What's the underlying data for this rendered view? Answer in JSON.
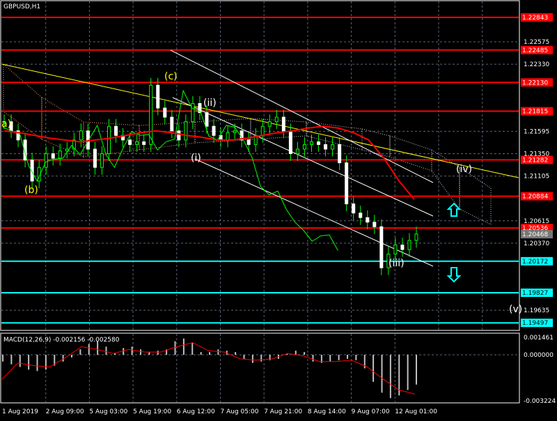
{
  "chart_title": "GBPUSD,H1",
  "chart_data": {
    "type": "candlestick",
    "symbol": "GBPUSD",
    "timeframe": "H1",
    "ylim": [
      1.1915,
      1.231
    ],
    "price_ticks": [
      "1.22575",
      "1.22330",
      "1.21595",
      "1.21350",
      "1.21105",
      "1.20615",
      "1.20370",
      "1.19635"
    ],
    "time_ticks": [
      "1 Aug 2019",
      "2 Aug 09:00",
      "5 Aug 03:00",
      "5 Aug 19:00",
      "6 Aug 12:00",
      "7 Aug 05:00",
      "7 Aug 21:00",
      "8 Aug 14:00",
      "9 Aug 07:00",
      "12 Aug 01:00"
    ],
    "closes": [
      1.217,
      1.216,
      1.215,
      1.2128,
      1.2105,
      1.212,
      1.2135,
      1.213,
      1.2138,
      1.214,
      1.215,
      1.216,
      1.214,
      1.212,
      1.2135,
      1.2165,
      1.2155,
      1.215,
      1.2145,
      1.2148,
      1.2145,
      1.221,
      1.2185,
      1.2175,
      1.216,
      1.215,
      1.217,
      1.219,
      1.218,
      1.2165,
      1.2155,
      1.215,
      1.2158,
      1.216,
      1.215,
      1.2145,
      1.2155,
      1.2165,
      1.217,
      1.2175,
      1.216,
      1.2135,
      1.214,
      1.2145,
      1.2148,
      1.2145,
      1.214,
      1.2145,
      1.2125,
      1.208,
      1.207,
      1.2065,
      1.206,
      1.2055,
      1.201,
      1.2025,
      1.2035,
      1.203,
      1.204,
      1.2047
    ],
    "red_ma": [
      1.216,
      1.2158,
      1.2155,
      1.2152,
      1.215,
      1.2148,
      1.215,
      1.2152,
      1.2155,
      1.2158,
      1.216,
      1.2158,
      1.2155,
      1.2153,
      1.215,
      1.215,
      1.2152,
      1.2155,
      1.2158,
      1.216,
      1.2163,
      1.2165,
      1.2163,
      1.2158,
      1.215,
      1.213,
      1.2105,
      1.2085
    ],
    "price_levels": [
      {
        "label": "1.22843",
        "price": 1.22843,
        "color": "#ff0000"
      },
      {
        "label": "1.22485",
        "price": 1.22485,
        "color": "#ff0000"
      },
      {
        "label": "1.22130",
        "price": 1.2213,
        "color": "#ff0000"
      },
      {
        "label": "1.21815",
        "price": 1.21815,
        "color": "#ff0000"
      },
      {
        "label": "1.21282",
        "price": 1.21282,
        "color": "#ff0000"
      },
      {
        "label": "1.20884",
        "price": 1.20884,
        "color": "#ff0000"
      },
      {
        "label": "1.20536",
        "price": 1.20536,
        "color": "#ff0000"
      },
      {
        "label": "1.20172",
        "price": 1.20172,
        "color": "#00ffff"
      },
      {
        "label": "1.19827",
        "price": 1.19827,
        "color": "#00ffff"
      },
      {
        "label": "1.19497",
        "price": 1.19497,
        "color": "#00ffff"
      }
    ],
    "current_price": {
      "label": "1.20468",
      "price": 1.20468
    },
    "wave_labels": [
      {
        "text": "a)",
        "color": "#ffff00"
      },
      {
        "text": "(b)",
        "color": "#ffff00"
      },
      {
        "text": "(c)",
        "color": "#ffff00"
      },
      {
        "text": "(i)",
        "color": "#ffffff"
      },
      {
        "text": "(ii)",
        "color": "#ffffff"
      },
      {
        "text": "(iii)",
        "color": "#ffffff"
      },
      {
        "text": "(iv)",
        "color": "#ffffff"
      },
      {
        "text": "(v)",
        "color": "#ffffff"
      }
    ],
    "macd": {
      "label": "MACD(12,26,9) -0.002156 -0.002580",
      "ticks": [
        "0.001461",
        "0.000000",
        "-0.003224"
      ],
      "ylim": [
        -0.003224,
        0.001461
      ],
      "histogram": [
        -0.0005,
        -0.0007,
        -0.0009,
        -0.0011,
        -0.0012,
        -0.0011,
        -0.0008,
        -0.0005,
        -0.0002,
        0.0004,
        0.0008,
        0.001,
        0.0006,
        0.0001,
        0.0005,
        0.0006,
        0.0004,
        0.0002,
        0.0003,
        0.0004,
        0.001,
        0.0012,
        0.0009,
        0.0002,
        0.0002,
        0.0004,
        0.0003,
        0.0002,
        -0.0003,
        -0.0006,
        -0.0005,
        -0.0004,
        -0.0003,
        0.0001,
        0.0003,
        0.0002,
        -0.0005,
        -0.0006,
        -0.0005,
        -0.0004,
        -0.0003,
        -0.0004,
        -0.001,
        -0.002,
        -0.0028,
        -0.0032,
        -0.003,
        -0.0026,
        -0.0022
      ],
      "signal": [
        -0.0018,
        -0.0006,
        -0.0008,
        -0.0009,
        -0.0002,
        0.0006,
        0.0004,
        0.0001,
        0.0004,
        0.0002,
        0.0002,
        0.0006,
        0.0009,
        0.0003,
        0.0002,
        -0.0003,
        -0.0004,
        -0.0003,
        0.0001,
        -0.0001,
        -0.0005,
        -0.0005,
        -0.0004,
        -0.0009,
        -0.0018,
        -0.0026,
        -0.0029
      ]
    }
  }
}
